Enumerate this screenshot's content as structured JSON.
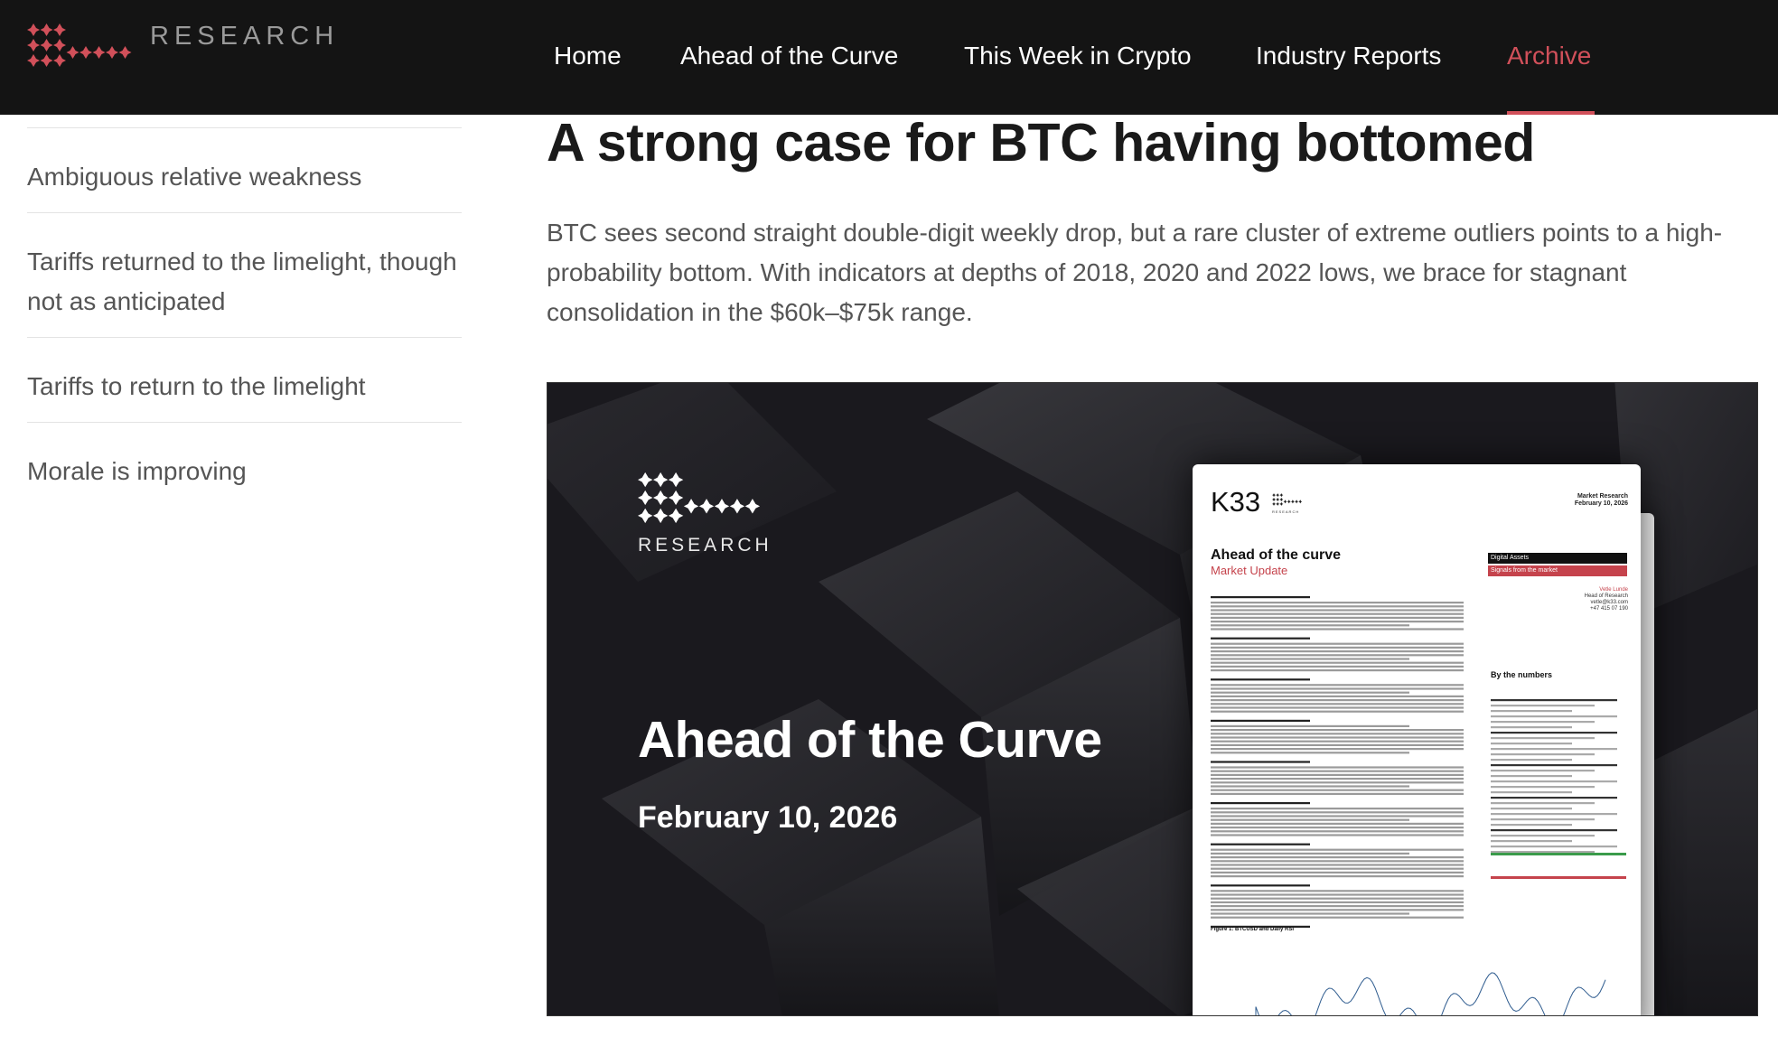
{
  "brand": {
    "name": "RESEARCH",
    "colors": {
      "topbar_bg": "#141414",
      "accent": "#d1505a",
      "nav_text": "#ffffff",
      "brand_text": "#9a9a9a"
    }
  },
  "nav": {
    "items": [
      {
        "label": "Home",
        "active": false
      },
      {
        "label": "Ahead of the Curve",
        "active": false
      },
      {
        "label": "This Week in Crypto",
        "active": false
      },
      {
        "label": "Industry Reports",
        "active": false
      },
      {
        "label": "Archive",
        "active": true
      }
    ]
  },
  "sidebar": {
    "items": [
      {
        "label": "Ambiguous relative weakness"
      },
      {
        "label": "Tariffs returned to the limelight, though not as anticipated"
      },
      {
        "label": "Tariffs to return to the limelight"
      },
      {
        "label": "Morale is improving"
      }
    ]
  },
  "article": {
    "title": "A strong case for BTC having bottomed",
    "lead": "BTC sees second straight double-digit weekly drop, but a rare cluster of extreme outliers points to a high-probability bottom. With indicators at depths of 2018, 2020 and 2022 lows, we brace for stagnant consolidation in the $60k–$75k range."
  },
  "hero": {
    "brand": "RESEARCH",
    "title": "Ahead of the Curve",
    "date": "February 10, 2026",
    "document": {
      "company": "K33",
      "company_sub": "RESEARCH",
      "header_right_1": "Market Research",
      "header_right_2": "February 10, 2026",
      "heading": "Ahead of the curve",
      "subheading": "Market Update",
      "tag_1": "Digital Assets",
      "tag_2": "Signals from the market",
      "author_name": "Vetle Lunde",
      "author_title": "Head of Research",
      "author_email": "vetle@k33.com",
      "author_phone": "+47 415 07 190",
      "section_numbers": "By the numbers",
      "figure_label": "Figure 1: BTCUSD and Daily RSI"
    }
  }
}
